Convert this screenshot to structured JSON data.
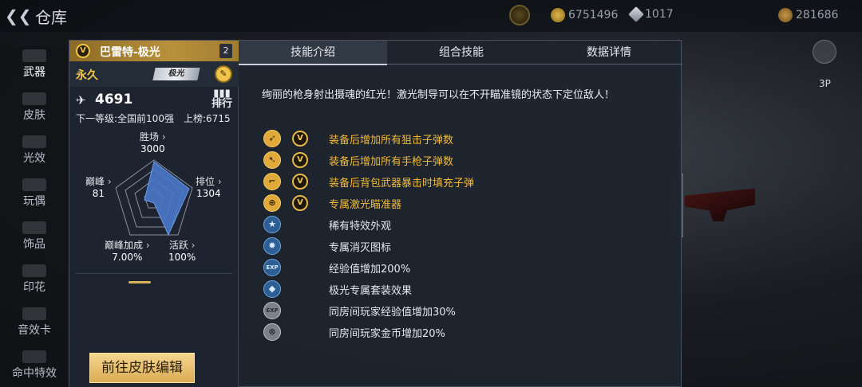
{
  "topbar": {
    "title": "仓库",
    "resource1": "6751496",
    "resource2": "1017",
    "resource3": "281686"
  },
  "leftnav": [
    {
      "label": "武器",
      "active": true
    },
    {
      "label": "皮肤"
    },
    {
      "label": "光效"
    },
    {
      "label": "玩偶"
    },
    {
      "label": "饰品"
    },
    {
      "label": "印花"
    },
    {
      "label": "音效卡"
    },
    {
      "label": "命中特效"
    }
  ],
  "card": {
    "title": "巴雷特-极光",
    "count": "2",
    "duration": "永久",
    "tag": "极光",
    "score": "4691",
    "rank_btn": "排行",
    "next_level": "下一等级:全国前100强",
    "on_board": "上榜:6715",
    "radar": {
      "win": {
        "label": "胜场",
        "value": "3000"
      },
      "rank": {
        "label": "排位",
        "value": "1304"
      },
      "active": {
        "label": "活跃",
        "value": "100%"
      },
      "bonus": {
        "label": "巅峰加成",
        "value": "7.00%"
      },
      "peak": {
        "label": "巅峰",
        "value": "81"
      }
    },
    "edit_button": "前往皮肤编辑"
  },
  "tabs": [
    "技能介绍",
    "组合技能",
    "数据详情"
  ],
  "description": "绚丽的枪身射出摄魂的红光！激光制导可以在不开瞄准镜的状态下定位敌人！",
  "skills": [
    {
      "text": "装备后增加所有狙击子弹数",
      "style": "gold",
      "icon": "sniper-bullet-icon",
      "v": true
    },
    {
      "text": "装备后增加所有手枪子弹数",
      "style": "gold",
      "icon": "pistol-bullet-icon",
      "v": true
    },
    {
      "text": "装备后背包武器暴击时填充子弹",
      "style": "gold",
      "icon": "pistol-icon",
      "v": true
    },
    {
      "text": "专属激光瞄准器",
      "style": "gold",
      "icon": "crosshair-icon",
      "v": true
    },
    {
      "text": "稀有特效外观",
      "style": "blue",
      "icon": "star-icon",
      "v": false
    },
    {
      "text": "专属消灭图标",
      "style": "blue",
      "icon": "kill-mark-icon",
      "v": false
    },
    {
      "text": "经验值增加200%",
      "style": "blue",
      "icon": "exp-icon",
      "v": false
    },
    {
      "text": "极光专属套装效果",
      "style": "blue",
      "icon": "suit-icon",
      "v": false
    },
    {
      "text": "同房间玩家经验值增加30%",
      "style": "grey",
      "icon": "room-exp-icon",
      "v": false
    },
    {
      "text": "同房间玩家金币增加20%",
      "style": "grey",
      "icon": "room-coin-icon",
      "v": false
    }
  ]
}
